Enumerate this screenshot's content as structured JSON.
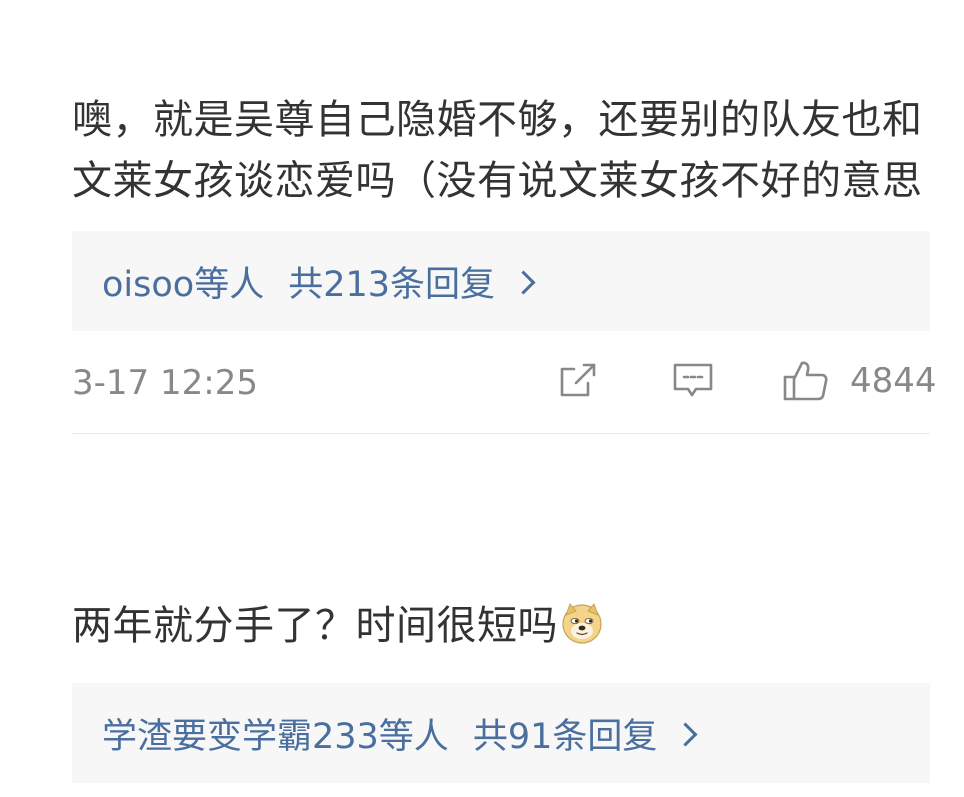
{
  "comments": [
    {
      "text": "噢，就是吴尊自己隐婚不够，还要别的队友也和文莱女孩谈恋爱吗（没有说文莱女孩不好的意思",
      "reply_users": "oisoo等人",
      "reply_count": "共213条回复",
      "timestamp": "3-17 12:25",
      "like_count": "4844",
      "icons": [
        "share-icon",
        "comment-icon",
        "like-icon",
        "chevron-right-icon"
      ]
    },
    {
      "text": "两年就分手了？时间很短吗",
      "emoji": "doge-emoji",
      "reply_users": "学渣要变学霸233等人",
      "reply_count": "共91条回复",
      "icons": [
        "chevron-right-icon"
      ]
    }
  ],
  "colors": {
    "text": "#333333",
    "link": "#4a6f9e",
    "meta": "#888888",
    "reply_bg": "#f7f7f7",
    "divider": "#e8e8e8"
  }
}
